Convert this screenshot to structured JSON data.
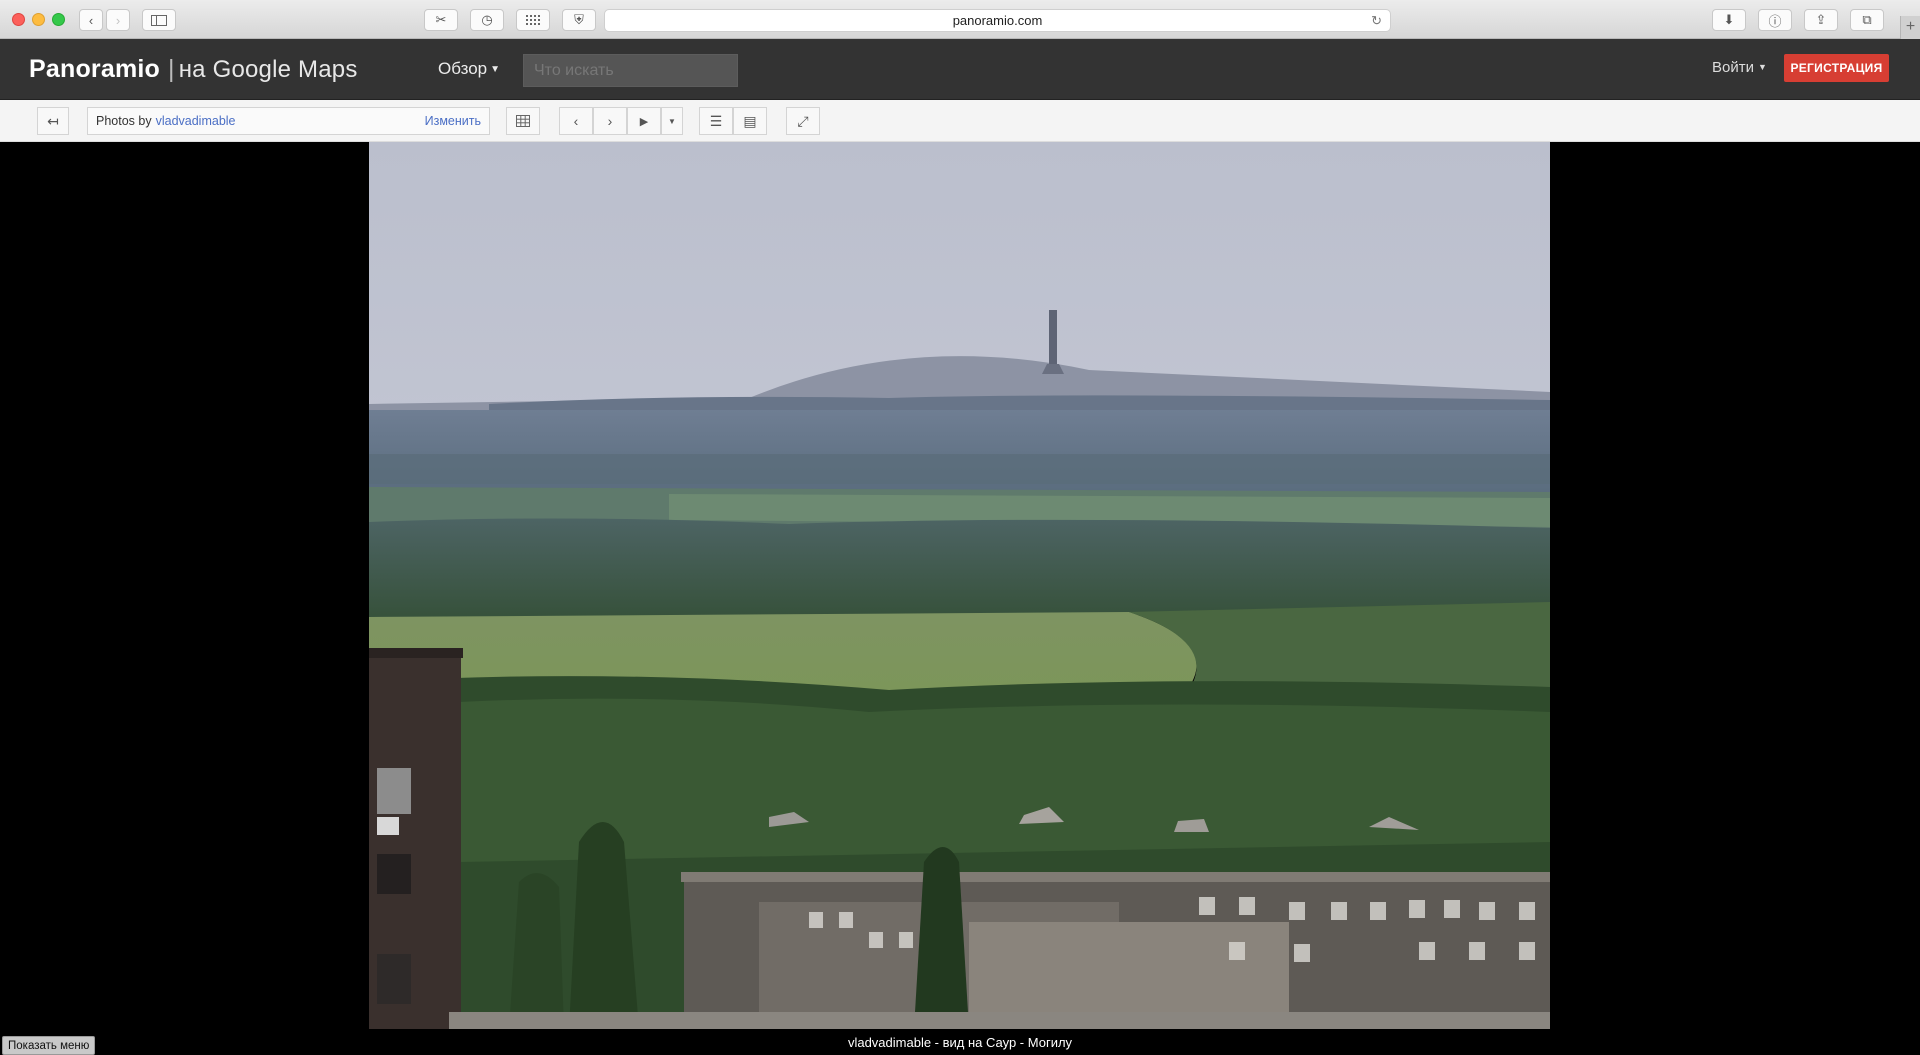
{
  "browser": {
    "url": "panoramio.com",
    "reader_icon": "reader-icon",
    "reload_icon": "reload-icon"
  },
  "header": {
    "logo_main": "Panoramio",
    "logo_sub": "на Google Maps",
    "explore_label": "Обзор",
    "search_placeholder": "Что искать",
    "login_label": "Войти",
    "register_label": "РЕГИСТРАЦИЯ"
  },
  "toolbar": {
    "photos_by_prefix": "Photos by",
    "photos_by_author": "vladvadimable",
    "change_label": "Изменить"
  },
  "photo": {
    "caption": "vladvadimable - вид на Саур - Могилу"
  },
  "footer": {
    "show_menu_label": "Показать меню"
  },
  "colors": {
    "header_bg": "#333333",
    "register_bg": "#d73e33",
    "link": "#4b6fc5"
  }
}
